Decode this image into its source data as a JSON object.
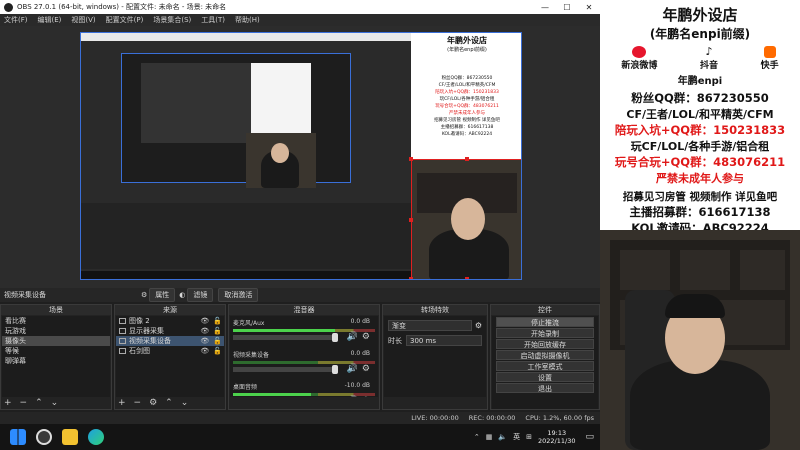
{
  "window": {
    "title": "OBS 27.0.1 (64-bit, windows) - 配置文件: 未命名 - 场景: 未命名",
    "controls": [
      "—",
      "☐",
      "✕"
    ]
  },
  "menu": [
    "文件(F)",
    "编辑(E)",
    "视图(V)",
    "配置文件(P)",
    "场景集合(S)",
    "工具(T)",
    "帮助(H)"
  ],
  "selected_source_label": "视频采集设备",
  "toolbar": {
    "properties": "属性",
    "filters": "滤镜",
    "deactivate": "取消激活"
  },
  "docks": {
    "scenes": {
      "title": "场景",
      "items": [
        "看比赛",
        "玩游戏",
        "摄像头",
        "等候",
        "聊弹幕"
      ],
      "selected_index": 2
    },
    "sources": {
      "title": "来源",
      "items": [
        "图像 2",
        "显示器采集",
        "视频采集设备",
        "石剑图"
      ],
      "selected_index": 2
    },
    "mixer": {
      "title": "混音器",
      "channels": [
        {
          "name": "麦克风/Aux",
          "db": "0.0 dB",
          "level": 0.72
        },
        {
          "name": "视频采集设备",
          "db": "0.0 dB",
          "level": 0.0
        },
        {
          "name": "桌面音频",
          "db": "-10.0 dB",
          "level": 0.55
        }
      ]
    },
    "transitions": {
      "title": "转场特效",
      "type": "渐变",
      "duration_label": "时长",
      "duration_value": "300 ms"
    },
    "controls": {
      "title": "控件",
      "buttons": [
        "停止推流",
        "开始录制",
        "开始回放缓存",
        "启动虚拟摄像机",
        "工作室模式",
        "设置",
        "退出"
      ]
    }
  },
  "status": {
    "live": "LIVE: 00:00:00",
    "rec": "REC: 00:00:00",
    "cpu": "CPU: 1.2%, 60.00 fps"
  },
  "taskbar": {
    "tray_lang": "英",
    "time": "19:13",
    "date": "2022/11/30"
  },
  "overlay": {
    "shop_name": "年鹏外设店",
    "shop_sub": "(年鹏名enpi前缀)",
    "platforms": [
      "新浪微博",
      "抖音",
      "快手"
    ],
    "account": "年鹏enpi",
    "lines": [
      {
        "text": "粉丝QQ群：867230550",
        "color": "#111111"
      },
      {
        "text": "CF/王者/LOL/和平精英/CFM",
        "color": "#111111"
      },
      {
        "text": "陪玩入坑+QQ群：150231833",
        "color": "#e01818"
      },
      {
        "text": "玩CF/LOL/各种手游/铝合租",
        "color": "#111111"
      },
      {
        "text": "玩号合玩+QQ群：483076211",
        "color": "#e01818"
      },
      {
        "text": "严禁未成年人参与",
        "color": "#e01818"
      },
      {
        "text": "招募见习房管 视频制作 详见鱼吧",
        "color": "#111111"
      },
      {
        "text": "主播招募群：616617138",
        "color": "#111111"
      },
      {
        "text": "KOL邀请码：ABC92224",
        "color": "#111111"
      }
    ]
  },
  "colors": {
    "selection": "#e02020",
    "accent_blue": "#3a6fd8",
    "meter_green": "#4cd24c"
  }
}
